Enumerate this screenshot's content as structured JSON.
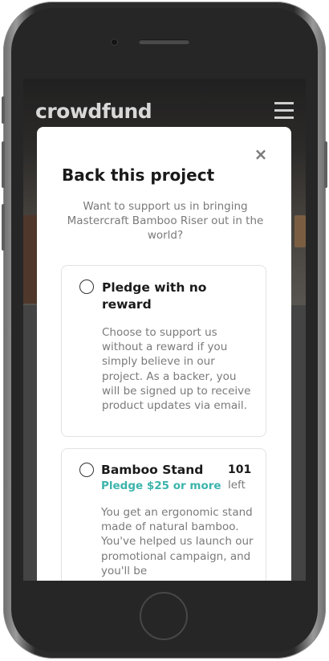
{
  "header": {
    "logo": "crowdfund"
  },
  "modal": {
    "close_icon": "×",
    "title": "Back this project",
    "description": "Want to support us in bringing Mastercraft Bamboo Riser out in the world?"
  },
  "rewards": [
    {
      "title": "Pledge with no reward",
      "description": "Choose to support us without a reward if you simply believe in our project. As a backer, you will be signed up to receive product updates via email."
    },
    {
      "title": "Bamboo Stand",
      "pledge": "Pledge $25 or more",
      "left_count": "101",
      "left_label": "left",
      "description": "You get an ergonomic stand made of natural bamboo. You've helped us launch our promotional campaign, and you'll be"
    }
  ],
  "colors": {
    "accent": "#3cb4ac",
    "text_dark": "#1a1a1a",
    "text_gray": "#7a7a7a"
  }
}
